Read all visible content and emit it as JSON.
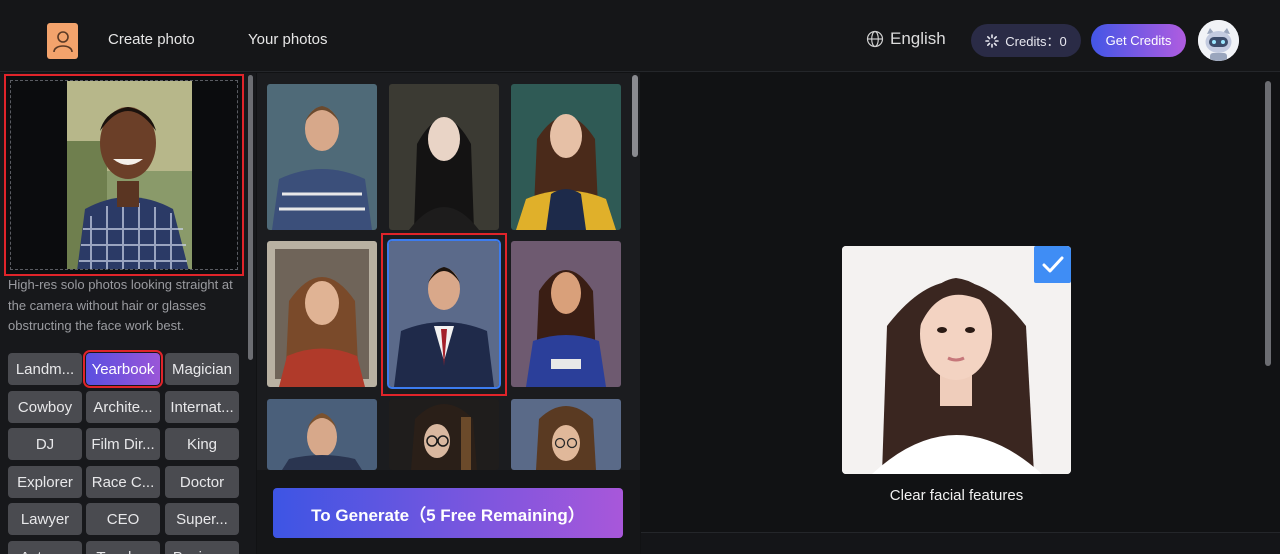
{
  "header": {
    "nav": [
      "Create photo",
      "Your photos"
    ],
    "language": "English",
    "credits_label": "Credits：0",
    "get_credits": "Get Credits"
  },
  "upload": {
    "hint": "High-res solo photos looking straight at the camera without hair or glasses obstructing the face work best."
  },
  "styles": {
    "tags": [
      "Landm...",
      "Yearbook",
      "Magician",
      "Cowboy",
      "Archite...",
      "Internat...",
      "DJ",
      "Film Dir...",
      "King",
      "Explorer",
      "Race C...",
      "Doctor",
      "Lawyer",
      "CEO",
      "Super...",
      "Actress",
      "Teacher",
      "Busine..."
    ],
    "selected": "Yearbook"
  },
  "gallery": {
    "selected_index": 4
  },
  "generate": {
    "label": "To Generate（5 Free Remaining）"
  },
  "example": {
    "caption": "Clear facial features"
  },
  "colors": {
    "accent_blue": "#3f8df5",
    "accent_purple": "#a857da",
    "highlight_red": "#e0242a"
  }
}
